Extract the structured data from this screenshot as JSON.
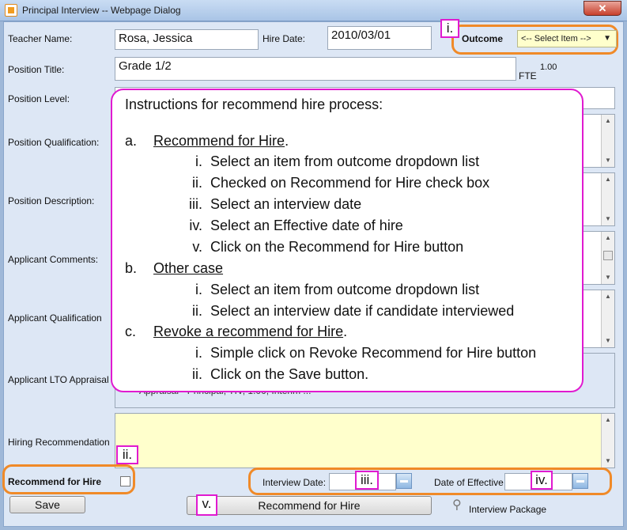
{
  "window": {
    "title": "Principal Interview -- Webpage Dialog",
    "close": "✕"
  },
  "form": {
    "teacher_name_label": "Teacher Name:",
    "teacher_name": "Rosa, Jessica",
    "hire_date_label": "Hire Date:",
    "hire_date": "2010/03/01",
    "outcome_label": "Outcome",
    "outcome_value": "<-- Select Item -->",
    "position_title_label": "Position Title:",
    "position_title": "Grade 1/2",
    "fte_label": "FTE",
    "fte_value": "1.00",
    "position_level_label": "Position Level:",
    "position_qualification_label": "Position Qualification:",
    "position_description_label": "Position Description:",
    "applicant_comments_label": "Applicant Comments:",
    "applicant_qualification_label": "Applicant Qualification",
    "applicant_lto_label": "Applicant LTO Appraisal",
    "applicant_lto_partial": "Appraisal - Principal, TIV, 1.00, Interim ...",
    "hiring_recommendation_label": "Hiring Recommendation",
    "recommend_for_hire_label": "Recommend for Hire",
    "interview_date_label": "Interview Date:",
    "effective_date_label": "Date of Effective"
  },
  "buttons": {
    "save": "Save",
    "recommend": "Recommend for Hire",
    "interview_package": "Interview Package"
  },
  "markers": {
    "i": "i.",
    "ii": "ii.",
    "iii": "iii.",
    "iv": "iv.",
    "v": "v."
  },
  "instructions": {
    "title": "Instructions for recommend hire process:",
    "a": {
      "letter": "a.",
      "heading": "Recommend for Hire",
      "suffix": ".",
      "items": [
        {
          "n": "i.",
          "t": "Select an item from outcome dropdown list"
        },
        {
          "n": "ii.",
          "t": "Checked on Recommend for Hire check box"
        },
        {
          "n": "iii.",
          "t": "Select an interview date"
        },
        {
          "n": "iv.",
          "t": "Select an Effective date of hire"
        },
        {
          "n": "v.",
          "t": "Click on the Recommend for Hire button"
        }
      ]
    },
    "b": {
      "letter": "b.",
      "heading": "Other case",
      "suffix": "",
      "items": [
        {
          "n": "i.",
          "t": "Select an item from outcome dropdown list"
        },
        {
          "n": "ii.",
          "t": "Select an interview date  if candidate interviewed"
        }
      ]
    },
    "c": {
      "letter": "c.",
      "heading": "Revoke a recommend for Hire",
      "suffix": ".",
      "items": [
        {
          "n": "i.",
          "t": "Simple click on Revoke Recommend for Hire button"
        },
        {
          "n": "ii.",
          "t": "Click on the Save button."
        }
      ]
    }
  },
  "colors": {
    "annotation_orange": "#f08a28",
    "annotation_magenta": "#e01ad0",
    "recommendation_bg": "#ffffcc",
    "outcome_bg": "#ffffcc"
  }
}
